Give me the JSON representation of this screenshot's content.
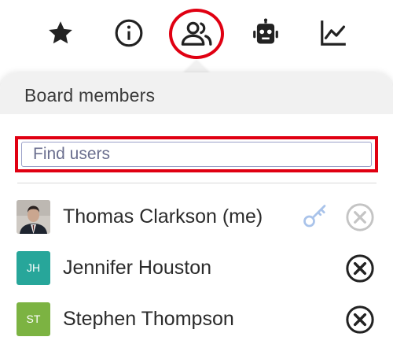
{
  "toolbar": {
    "items": [
      {
        "name": "star-icon",
        "active": false
      },
      {
        "name": "info-icon",
        "active": false
      },
      {
        "name": "members-icon",
        "active": true
      },
      {
        "name": "robot-icon",
        "active": false
      },
      {
        "name": "chart-icon",
        "active": false
      }
    ],
    "icon_color": "#222222",
    "highlight_color": "#e00012"
  },
  "panel": {
    "title": "Board members",
    "search": {
      "placeholder": "Find users",
      "value": ""
    },
    "members": [
      {
        "name": "Thomas Clarkson (me)",
        "initials": "",
        "avatar_type": "photo",
        "avatar_color": "#d9d6d2",
        "is_admin": true,
        "remove_enabled": false
      },
      {
        "name": "Jennifer Houston",
        "initials": "JH",
        "avatar_type": "initials",
        "avatar_color": "#27a69a",
        "is_admin": false,
        "remove_enabled": true
      },
      {
        "name": "Stephen Thompson",
        "initials": "ST",
        "avatar_type": "initials",
        "avatar_color": "#7cb342",
        "is_admin": false,
        "remove_enabled": true
      }
    ],
    "admin_key_color": "#a9c3ea"
  }
}
